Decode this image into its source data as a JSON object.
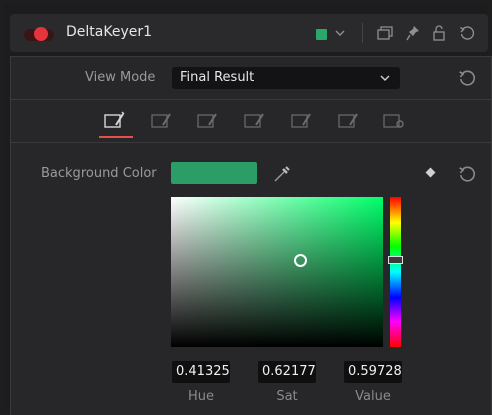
{
  "node": {
    "title": "DeltaKeyer1",
    "enabled": true,
    "color_swatch": "#2aa86a"
  },
  "header_icons": [
    "color-dropdown-chevron-icon",
    "versions-icon",
    "pin-icon",
    "lock-icon",
    "reset-icon"
  ],
  "view_mode": {
    "label": "View Mode",
    "value": "Final Result"
  },
  "tabs": [
    {
      "name": "keyer-tab",
      "active": true
    },
    {
      "name": "pre-matte-tab",
      "active": false
    },
    {
      "name": "matte-tab",
      "active": false
    },
    {
      "name": "fine-tune-tab",
      "active": false
    },
    {
      "name": "image-tab",
      "active": false
    },
    {
      "name": "garbage-matte-tab",
      "active": false
    },
    {
      "name": "settings-tab",
      "active": false
    }
  ],
  "background_color": {
    "label": "Background Color",
    "swatch": "#2b9e67",
    "hue": "0.41325",
    "sat": "0.62177",
    "value": "0.59728",
    "hue_label": "Hue",
    "sat_label": "Sat",
    "value_label": "Value"
  },
  "accent": "#e0524a"
}
